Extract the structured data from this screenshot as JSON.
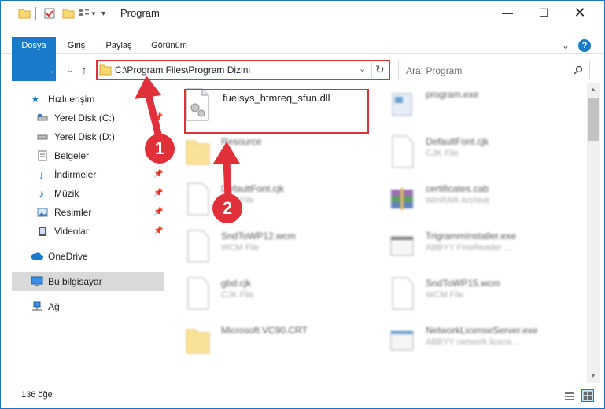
{
  "window": {
    "title": "Program"
  },
  "ribbon": {
    "tabs": [
      "Dosya",
      "Giriş",
      "Paylaş",
      "Görünüm"
    ]
  },
  "nav": {
    "address": "C:\\Program Files\\Program Dizini",
    "search_placeholder": "Ara: Program"
  },
  "sidebar": {
    "items": [
      {
        "label": "Hızlı erişim",
        "icon": "star-icon",
        "pinned": false
      },
      {
        "label": "Yerel Disk (C:)",
        "icon": "drive-icon",
        "pinned": true
      },
      {
        "label": "Yerel Disk (D:)",
        "icon": "drive-icon",
        "pinned": true
      },
      {
        "label": "Belgeler",
        "icon": "documents-icon",
        "pinned": true
      },
      {
        "label": "İndirmeler",
        "icon": "download-icon",
        "pinned": true
      },
      {
        "label": "Müzik",
        "icon": "music-icon",
        "pinned": true
      },
      {
        "label": "Resimler",
        "icon": "pictures-icon",
        "pinned": true
      },
      {
        "label": "Videolar",
        "icon": "video-icon",
        "pinned": true
      },
      {
        "label": "OneDrive",
        "icon": "cloud-icon",
        "pinned": false
      },
      {
        "label": "Bu bilgisayar",
        "icon": "computer-icon",
        "pinned": false
      },
      {
        "label": "Ağ",
        "icon": "network-icon",
        "pinned": false
      }
    ]
  },
  "files": [
    {
      "name": "fuelsys_htmreq_sfun.dll",
      "type": "",
      "icon": "dll-file-icon"
    },
    {
      "name": "program.exe",
      "type": "",
      "icon": "exe-file-icon"
    },
    {
      "name": "Resource",
      "type": "",
      "icon": "folder-icon"
    },
    {
      "name": "DefaultFont.cjk",
      "type": "CJK File",
      "icon": "generic-file-icon"
    },
    {
      "name": "DefaultFont.cjk",
      "type": "CJK File",
      "icon": "generic-file-icon"
    },
    {
      "name": "certificates.cab",
      "type": "WinRAR Archive",
      "icon": "archive-icon"
    },
    {
      "name": "SndToWP12.wcm",
      "type": "WCM File",
      "icon": "generic-file-icon"
    },
    {
      "name": "TrigrammInstaller.exe",
      "type": "ABBYY FineReader ...",
      "icon": "exe-file-icon"
    },
    {
      "name": "gbd.cjk",
      "type": "CJK File",
      "icon": "generic-file-icon"
    },
    {
      "name": "SndToWP15.wcm",
      "type": "WCM File",
      "icon": "generic-file-icon"
    },
    {
      "name": "Microsoft.VC90.CRT",
      "type": "",
      "icon": "folder-icon"
    },
    {
      "name": "NetworkLicenseServer.exe",
      "type": "ABBYY network licens...",
      "icon": "exe-file-icon"
    }
  ],
  "status": {
    "item_count": "136 öğe"
  },
  "callouts": [
    "1",
    "2"
  ],
  "colors": {
    "accent": "#1979ca",
    "highlight": "#e0303a"
  }
}
